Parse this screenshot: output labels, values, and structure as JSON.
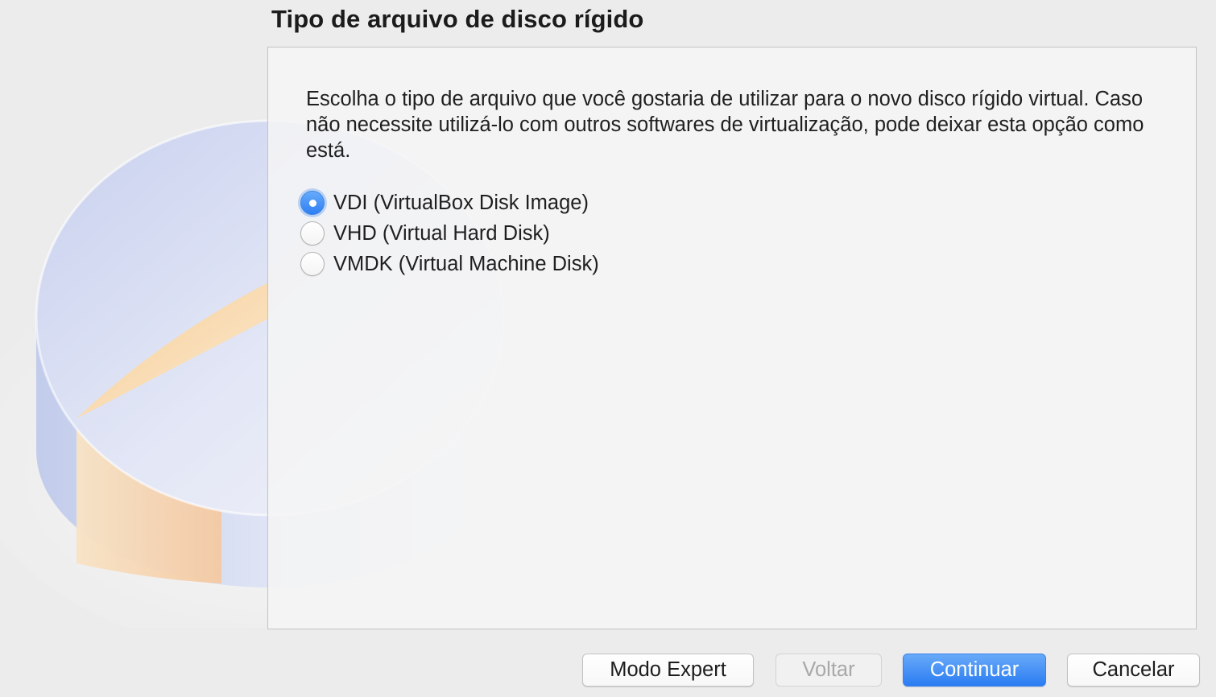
{
  "wizard": {
    "title": "Tipo de arquivo de disco rígido",
    "description": "Escolha o tipo de arquivo que você gostaria de utilizar para o novo disco rígido virtual. Caso não necessite utilizá-lo com outros softwares de virtualização, pode deixar esta opção como está.",
    "options": [
      {
        "label": "VDI (VirtualBox Disk Image)",
        "selected": true
      },
      {
        "label": "VHD (Virtual Hard Disk)",
        "selected": false
      },
      {
        "label": "VMDK (Virtual Machine Disk)",
        "selected": false
      }
    ]
  },
  "buttons": {
    "expert": "Modo Expert",
    "back": "Voltar",
    "continue": "Continuar",
    "cancel": "Cancelar"
  },
  "colors": {
    "accent": "#2f7ff3",
    "background": "#ececec",
    "disk_blue": "#c9d3ef",
    "disk_orange": "#f6d3a8"
  }
}
